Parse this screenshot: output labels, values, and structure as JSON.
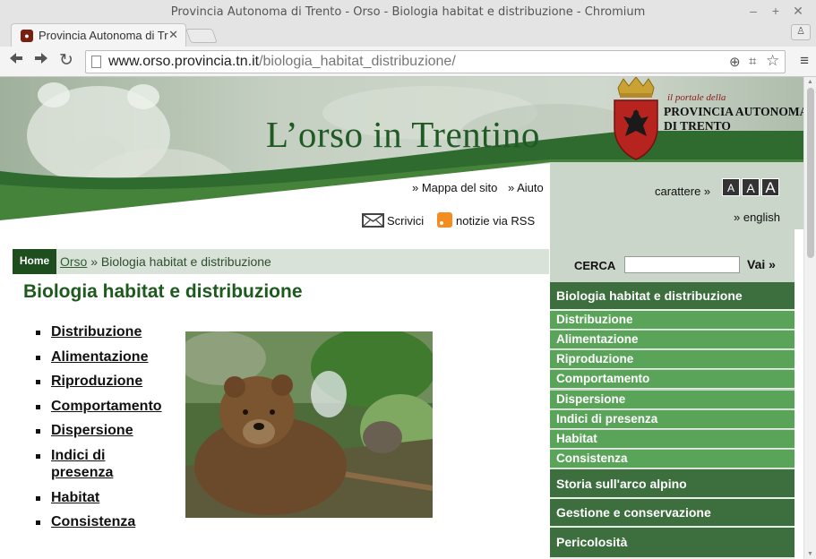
{
  "window": {
    "title": "Provincia Autonoma di Trento - Orso - Biologia habitat e distribuzione - Chromium",
    "tab_label": "Provincia Autonoma di Tr",
    "close_glyph": "✕",
    "minimize_glyph": "‒",
    "maximize_glyph": "+",
    "profile_glyph": "♙"
  },
  "toolbar": {
    "back_glyph": "🡐",
    "forward_glyph": "🡒",
    "reload_glyph": "↻",
    "url_domain": "www.orso.provincia.tn.it",
    "url_path": "/biologia_habitat_distribuzione/",
    "zoom_glyph": "⊕",
    "translate_glyph": "⌗",
    "star_glyph": "☆",
    "menu_glyph": "≡"
  },
  "banner": {
    "site_title": "L’orso in Trentino",
    "portal_small": "il portale della",
    "portal_line1": "PROVINCIA AUTONOMA",
    "portal_line2": "DI TRENTO"
  },
  "toplinks": {
    "sitemap": "» Mappa del sito",
    "help": "» Aiuto",
    "write": "Scrivici",
    "rss": "notizie via RSS",
    "font_label": "carattere »",
    "font_sizes": [
      "A",
      "A",
      "A"
    ],
    "english": "» english"
  },
  "breadcrumb": {
    "home": "Home",
    "parent": "Orso",
    "separator": " » ",
    "current": "Biologia habitat e distribuzione"
  },
  "page_title": "Biologia habitat e distribuzione",
  "content_links": [
    "Distribuzione",
    "Alimentazione",
    "Riproduzione",
    "Comportamento",
    "Dispersione",
    "Indici di presenza",
    "Habitat",
    "Consistenza"
  ],
  "search": {
    "label": "CERCA",
    "placeholder": "",
    "button": "Vai »"
  },
  "sidemenu": {
    "active": "Biologia habitat e distribuzione",
    "subitems": [
      "Distribuzione",
      "Alimentazione",
      "Riproduzione",
      "Comportamento",
      "Dispersione",
      "Indici di presenza",
      "Habitat",
      "Consistenza"
    ],
    "sections": [
      "Storia sull'arco alpino",
      "Gestione e conservazione",
      "Pericolosità"
    ]
  },
  "colors": {
    "dark_green": "#3d6e3d",
    "menu_green": "#5aa45a",
    "title_green": "#1e5a1e",
    "panel_bg": "#c9d6c9"
  }
}
